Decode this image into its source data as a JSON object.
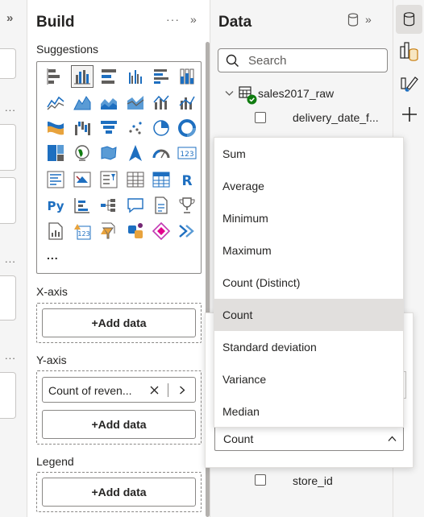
{
  "left_strip": {
    "collapse_glyph": "»",
    "dots": [
      "...",
      "...",
      "..."
    ]
  },
  "build": {
    "title": "Build",
    "more": "···",
    "collapse": "»",
    "suggestions_label": "Suggestions",
    "more_visuals": "...",
    "xaxis": {
      "label": "X-axis",
      "add": "+Add data"
    },
    "yaxis": {
      "label": "Y-axis",
      "field": "Count of reven...",
      "add": "+Add data"
    },
    "legend": {
      "label": "Legend",
      "add": "+Add data"
    },
    "viz_icons": [
      "stacked-bar-icon",
      "clustered-column-icon",
      "stacked-bar-100-icon",
      "clustered-column-2-icon",
      "clustered-bar-icon",
      "column-100-icon",
      "line-chart-icon",
      "area-chart-icon",
      "stacked-area-icon",
      "line-area-icon",
      "line-column-icon",
      "line-column-2-icon",
      "ribbon-chart-icon",
      "waterfall-icon",
      "funnel-icon",
      "scatter-icon",
      "pie-icon",
      "donut-icon",
      "treemap-icon",
      "globe-map-icon",
      "filled-map-icon",
      "azure-map-icon",
      "gauge-icon",
      "card-123-icon",
      "multirow-card-icon",
      "kpi-icon",
      "slicer-icon",
      "table-icon",
      "matrix-icon",
      "r-visual-icon",
      "python-visual-icon",
      "key-influencers-icon",
      "decomposition-tree-icon",
      "qa-icon",
      "narrative-icon",
      "trophy-icon",
      "paginated-report-icon",
      "metrics-card-icon",
      "power-apps-icon",
      "power-automate-icon",
      "diamond-visual-icon",
      "arrows-visual-icon"
    ]
  },
  "data": {
    "title": "Data",
    "more": "···",
    "collapse": "»",
    "search_placeholder": "Search",
    "table_name": "sales2017_raw",
    "fields": [
      "delivery_date_f...",
      "store_id"
    ]
  },
  "aggregation_menu": {
    "items": [
      "Sum",
      "Average",
      "Minimum",
      "Maximum",
      "Count (Distinct)",
      "Count",
      "Standard deviation",
      "Variance",
      "Median"
    ],
    "selected": "Count"
  },
  "aggregation_select": {
    "value": "Count"
  },
  "colors": {
    "accent": "#118dff",
    "selected_bg": "#e1dfdd",
    "green": "#107c10"
  }
}
